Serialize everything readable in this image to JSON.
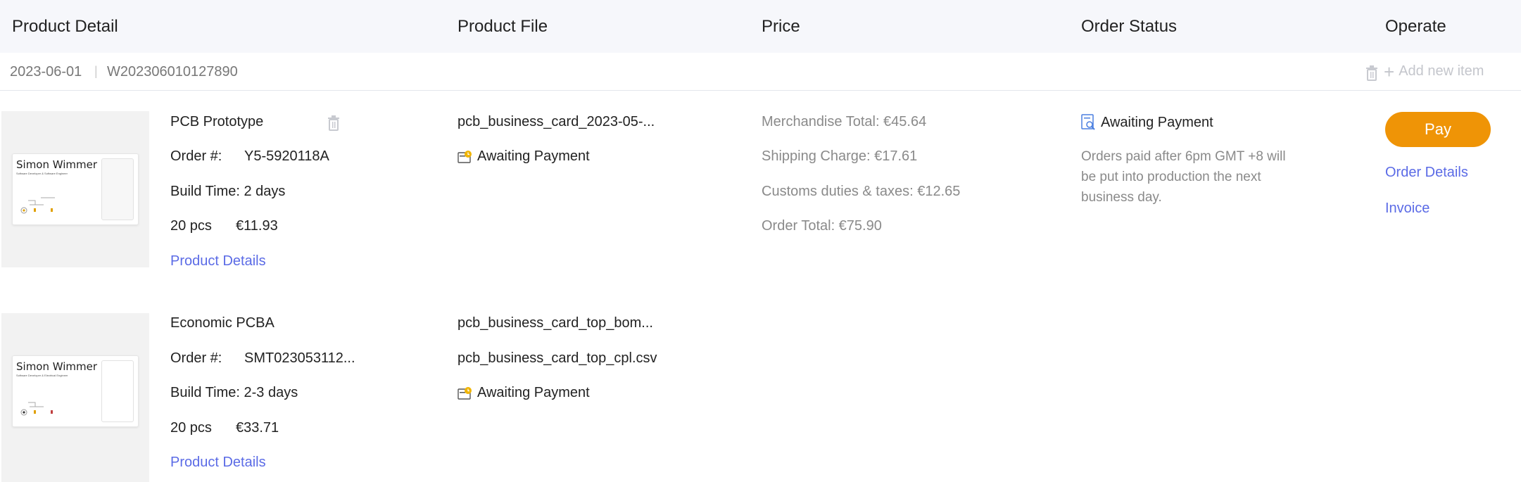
{
  "header": {
    "product_detail": "Product Detail",
    "product_file": "Product File",
    "price": "Price",
    "order_status": "Order Status",
    "operate": "Operate"
  },
  "order": {
    "date": "2023-06-01",
    "separator": "|",
    "number": "W202306010127890",
    "add_item": "Add new item"
  },
  "items": [
    {
      "card_name": "Simon Wimmer",
      "card_tagline": "Software Developer & Software Engineer",
      "name": "PCB Prototype",
      "order_label": "Order #:",
      "order_no": "Y5-5920118A",
      "build_time": "Build Time: 2 days",
      "qty": "20 pcs",
      "price": "€11.93",
      "details_link": "Product Details",
      "files": [
        "pcb_business_card_2023-05-..."
      ],
      "file_status": "Awaiting Payment"
    },
    {
      "card_name": "Simon Wimmer",
      "card_tagline": "Software Developer & Electrical Engineer",
      "name": "Economic PCBA",
      "order_label": "Order #:",
      "order_no": "SMT023053112...",
      "build_time": "Build Time: 2-3 days",
      "qty": "20 pcs",
      "price": "€33.71",
      "details_link": "Product Details",
      "files": [
        "pcb_business_card_top_bom...",
        "pcb_business_card_top_cpl.csv"
      ],
      "file_status": "Awaiting Payment"
    }
  ],
  "price": {
    "merchandise": "Merchandise Total: €45.64",
    "shipping": "Shipping Charge: €17.61",
    "customs": "Customs duties & taxes: €12.65",
    "total": "Order Total: €75.90"
  },
  "status": {
    "label": "Awaiting Payment",
    "note": "Orders paid after 6pm GMT +8 will be put into production the next business day."
  },
  "operate": {
    "pay": "Pay",
    "order_details": "Order Details",
    "invoice": "Invoice"
  },
  "colors": {
    "accent_orange": "#ef9406",
    "link_blue": "#5b6be6",
    "header_bg": "#f6f7fb",
    "muted_text": "#8a8a8a"
  },
  "icons": [
    "trash-icon",
    "plus-icon",
    "file-status-icon",
    "order-status-icon"
  ]
}
